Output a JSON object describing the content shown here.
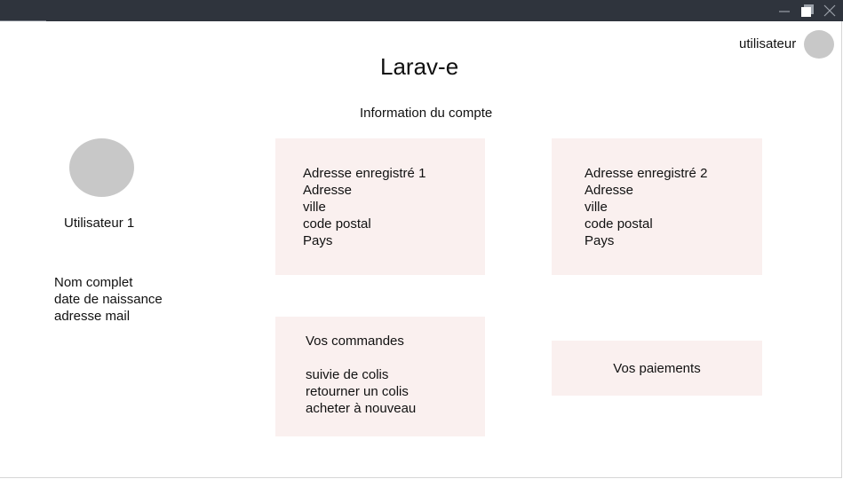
{
  "header": {
    "user_label": "utilisateur",
    "app_title": "Larav-e",
    "section_title": "Information du compte"
  },
  "window_controls": {
    "minimize": "minimize-icon",
    "maximize": "maximize-icon",
    "close": "close-icon"
  },
  "profile": {
    "name": "Utilisateur 1",
    "details": [
      "Nom complet",
      "date de naissance",
      "adresse mail"
    ]
  },
  "addresses": [
    {
      "title": "Adresse enregistré 1",
      "lines": [
        "Adresse",
        "ville",
        "code postal",
        "Pays"
      ]
    },
    {
      "title": "Adresse enregistré 2",
      "lines": [
        "Adresse",
        "ville",
        "code postal",
        "Pays"
      ]
    }
  ],
  "orders": {
    "title": "Vos commandes",
    "links": [
      "suivie de colis",
      "retourner un colis",
      "acheter à nouveau"
    ]
  },
  "payments": {
    "title": "Vos paiements"
  },
  "colors": {
    "titlebar": "#2f343d",
    "card_background": "#faf0ef",
    "avatar_placeholder": "#c8c8c8"
  }
}
